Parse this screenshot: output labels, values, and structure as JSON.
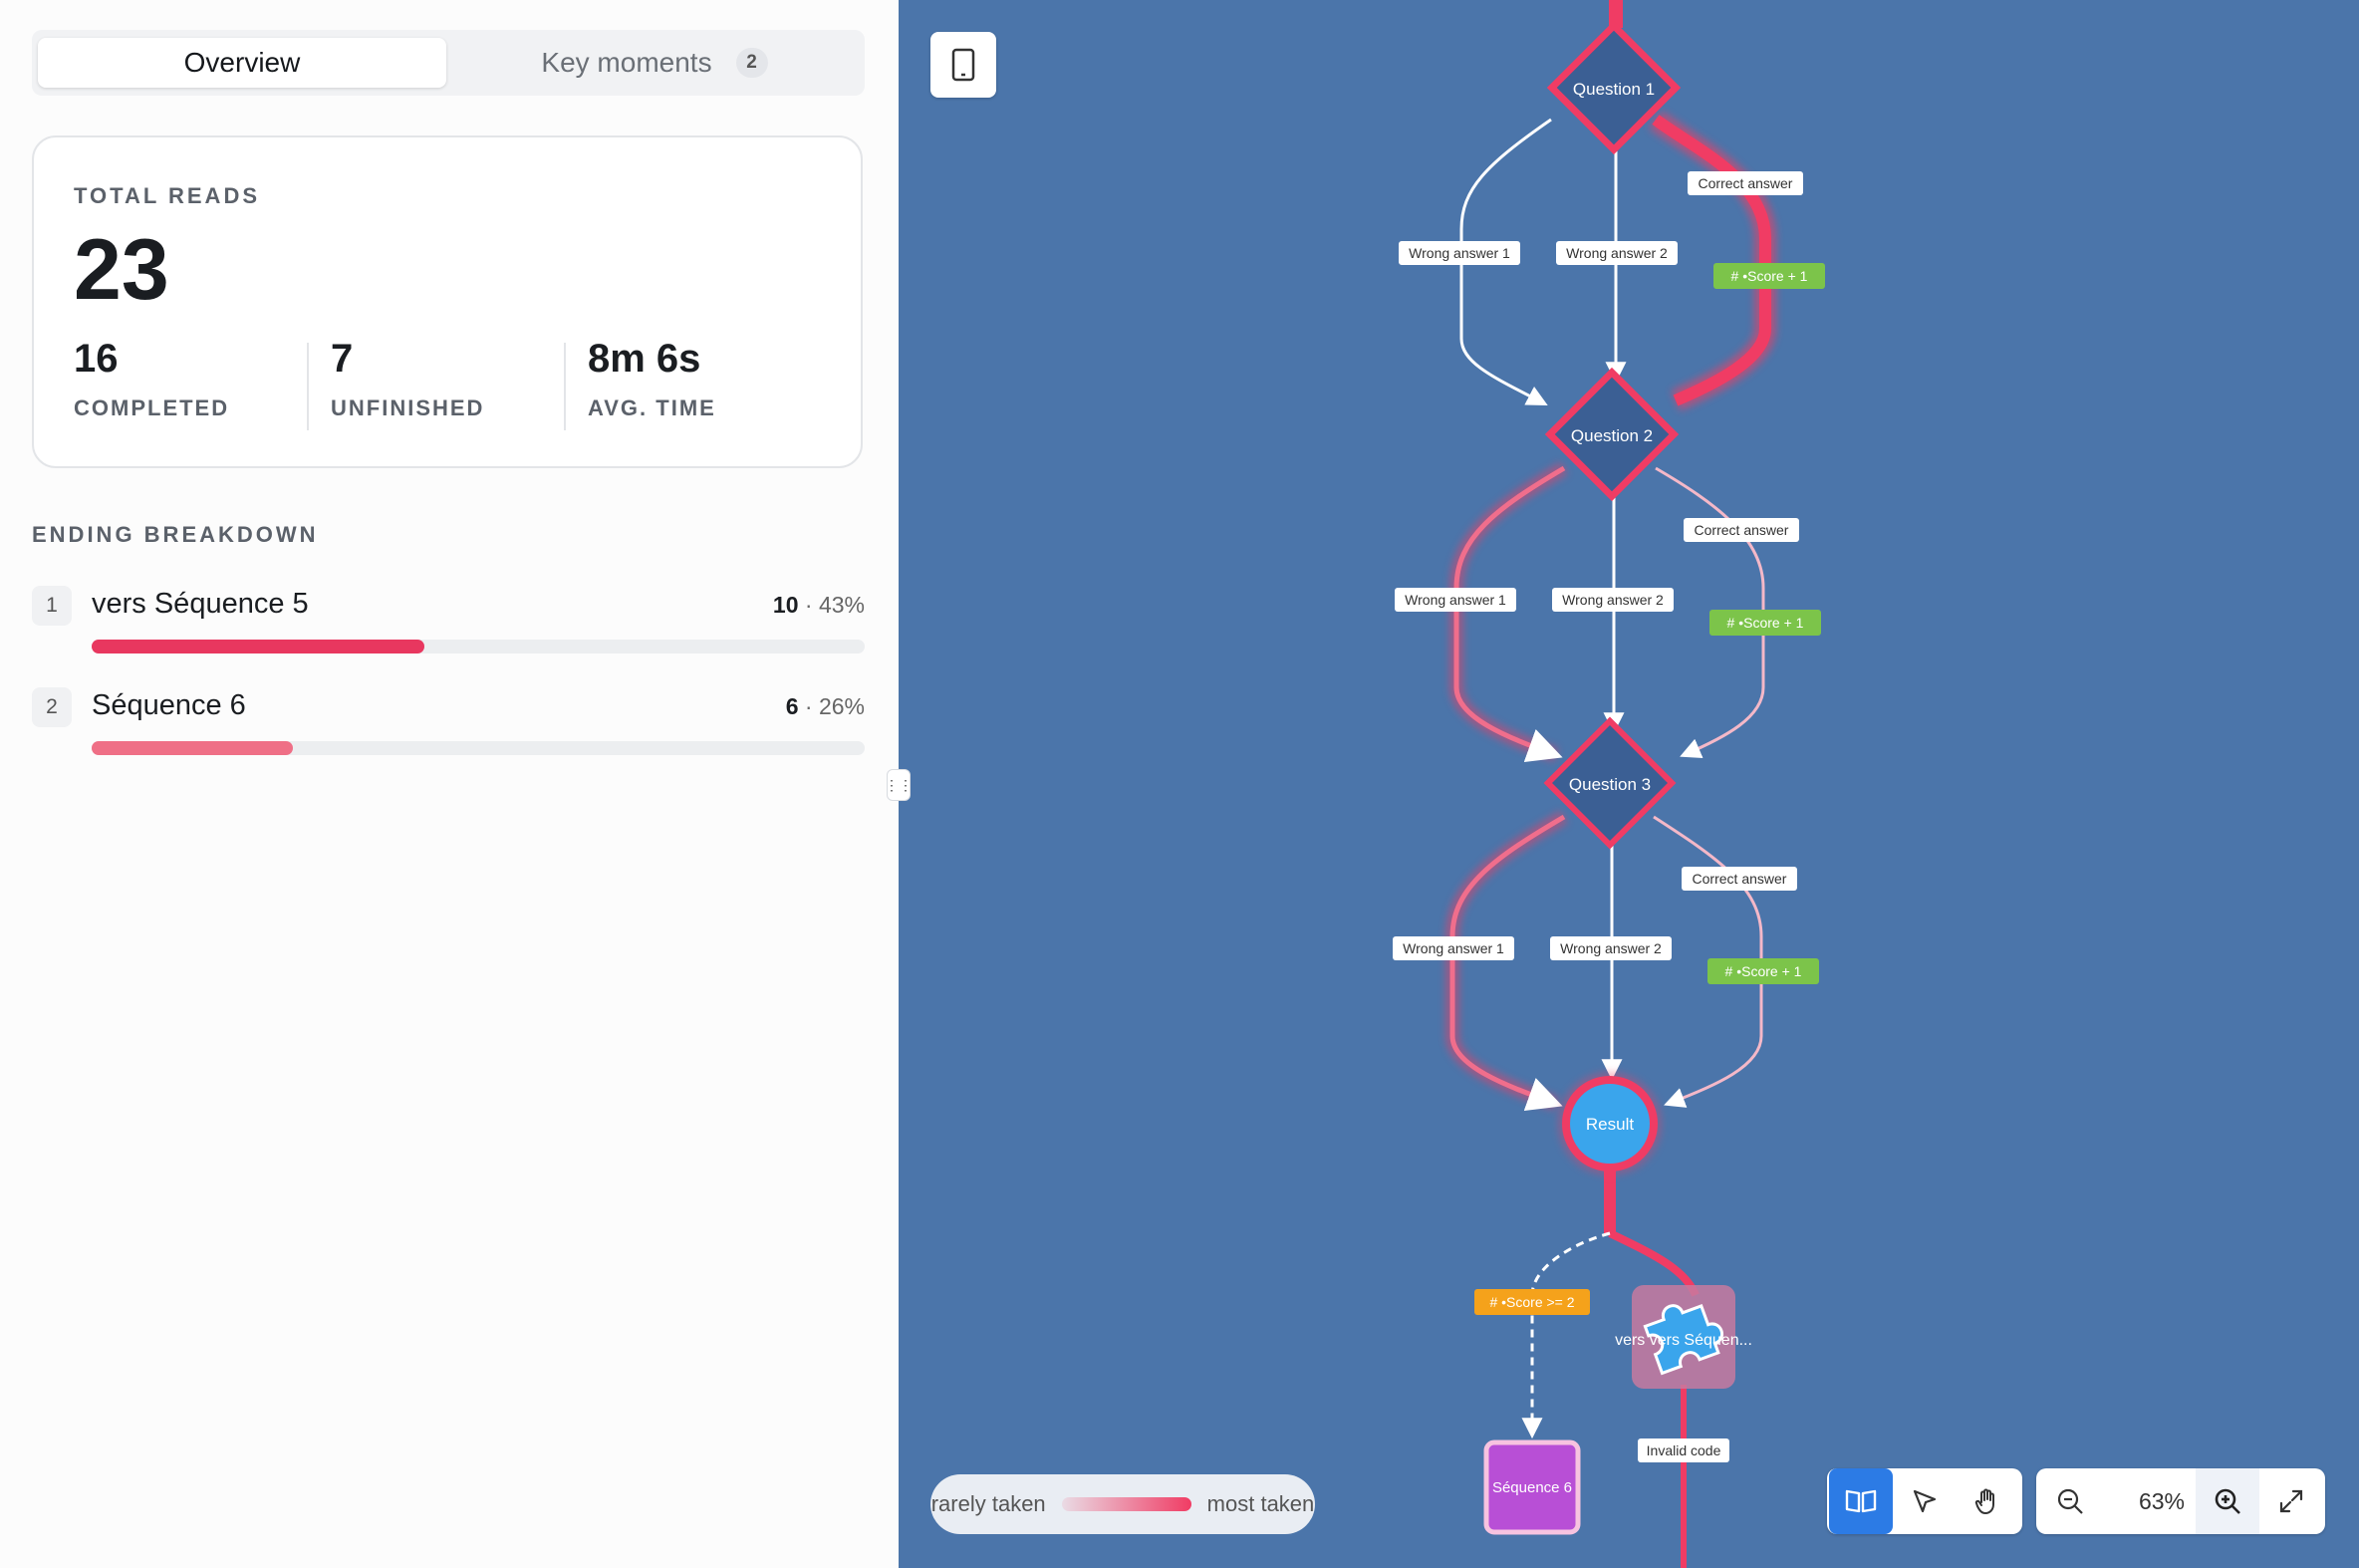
{
  "tabs": {
    "overview": "Overview",
    "key_moments": "Key moments",
    "key_moments_count": "2"
  },
  "summary": {
    "total_reads_label": "TOTAL READS",
    "total_reads": "23",
    "completed": "16",
    "completed_label": "COMPLETED",
    "unfinished": "7",
    "unfinished_label": "UNFINISHED",
    "avg_time": "8m 6s",
    "avg_time_label": "AVG. TIME"
  },
  "ending_breakdown": {
    "title": "ENDING BREAKDOWN",
    "items": [
      {
        "rank": "1",
        "name": "vers Séquence 5",
        "count": "10",
        "percent": "· 43%",
        "fraction": 0.43,
        "color": "#e8375f"
      },
      {
        "rank": "2",
        "name": "Séquence 6",
        "count": "6",
        "percent": "· 26%",
        "fraction": 0.26,
        "color": "#ef6f86"
      }
    ]
  },
  "graph": {
    "questions": [
      "Question 1",
      "Question 2",
      "Question 3"
    ],
    "edge_labels": {
      "correct": "Correct answer",
      "wrong1": "Wrong answer 1",
      "wrong2": "Wrong answer 2"
    },
    "score_tag": "# •Score + 1",
    "result": "Result",
    "condition_tag": "# •Score >= 2",
    "puzzle_label": "vers vers Séquen...",
    "invalid_code": "Invalid code",
    "sequence6": "Séquence 6"
  },
  "legend": {
    "rarely": "rarely taken",
    "most": "most taken"
  },
  "zoom": {
    "level": "63%"
  },
  "colors": {
    "canvas": "#4b75aa",
    "hot": "#f03c64",
    "node": "#3b5f94",
    "score": "#7cc44a",
    "condition": "#f5a21b",
    "sequence": "#b84fd6",
    "result": "#3aa5ec",
    "accent": "#2c7be5"
  }
}
